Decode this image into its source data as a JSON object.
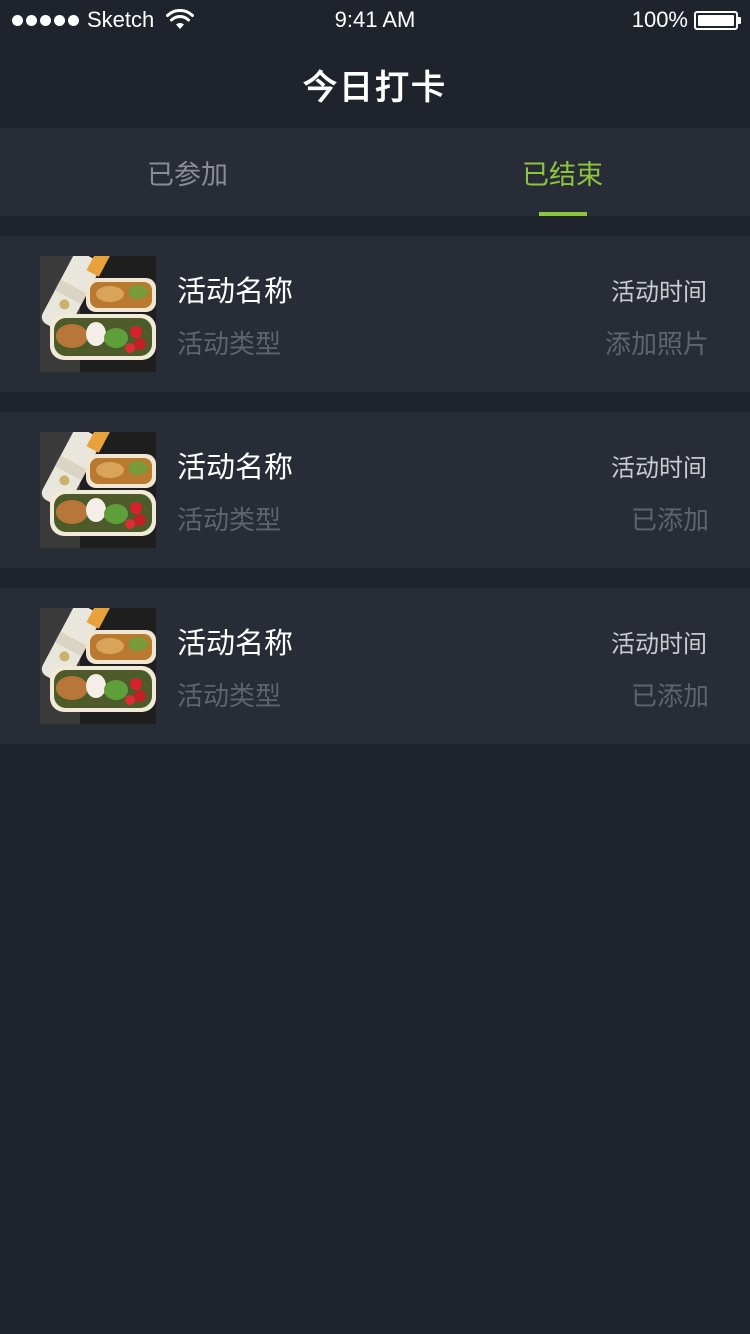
{
  "status_bar": {
    "carrier": "Sketch",
    "time": "9:41 AM",
    "battery": "100%"
  },
  "nav": {
    "title": "今日打卡"
  },
  "tabs": [
    {
      "label": "已参加",
      "active": false
    },
    {
      "label": "已结束",
      "active": true
    }
  ],
  "colors": {
    "accent": "#8cc63f",
    "background": "#1f232c",
    "card": "#272c37"
  },
  "items": [
    {
      "name": "活动名称",
      "type": "活动类型",
      "time": "活动时间",
      "status": "添加照片",
      "image": "food-photo"
    },
    {
      "name": "活动名称",
      "type": "活动类型",
      "time": "活动时间",
      "status": "已添加",
      "image": "food-photo"
    },
    {
      "name": "活动名称",
      "type": "活动类型",
      "time": "活动时间",
      "status": "已添加",
      "image": "food-photo"
    }
  ]
}
